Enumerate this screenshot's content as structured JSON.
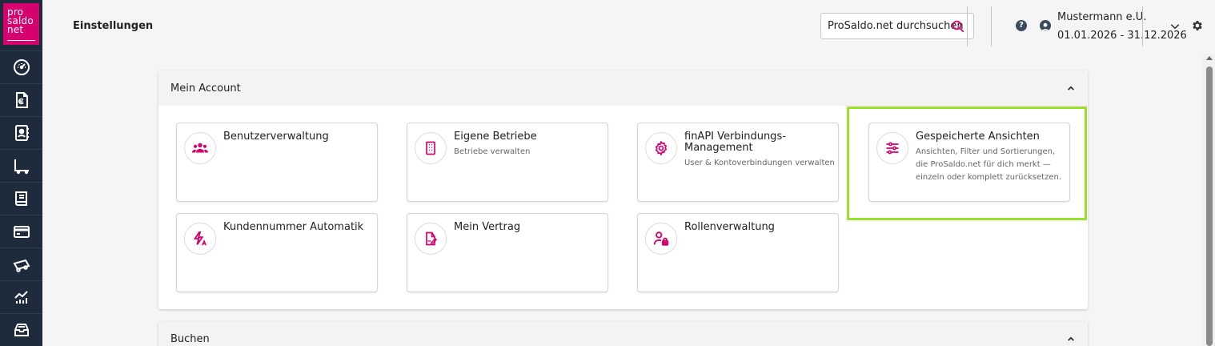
{
  "logo": {
    "line1": "pro",
    "line2": "saldo",
    "line3": "net"
  },
  "sidebar": {
    "items": [
      {
        "icon": "dashboard-icon"
      },
      {
        "icon": "euro-document-icon"
      },
      {
        "icon": "contacts-icon"
      },
      {
        "icon": "ledger-icon"
      },
      {
        "icon": "book-icon"
      },
      {
        "icon": "credit-card-icon"
      },
      {
        "icon": "vehicle-icon"
      },
      {
        "icon": "chart-icon"
      },
      {
        "icon": "inbox-icon"
      }
    ]
  },
  "header": {
    "title": "Einstellungen",
    "search_placeholder": "ProSaldo.net durchsuchen",
    "user_name": "Mustermann e.U.",
    "period": "01.01.2026 - 31.12.2026",
    "help_label": "?"
  },
  "sections": [
    {
      "title": "Mein Account",
      "cards": [
        {
          "title": "Benutzerverwaltung",
          "desc": "",
          "icon": "users-icon"
        },
        {
          "title": "Eigene Betriebe",
          "desc": "Betriebe verwalten",
          "icon": "building-icon"
        },
        {
          "title": "finAPI Verbindungs-Management",
          "desc": "User & Kontoverbindungen verwalten",
          "icon": "settings-gear-icon"
        },
        {
          "title": "Gespeicherte Ansichten",
          "desc": "Ansichten, Filter und Sortierungen, die ProSaldo.net für dich merkt — einzeln oder komplett zurücksetzen.",
          "icon": "sliders-icon"
        },
        {
          "title": "Kundennummer Automatik",
          "desc": "",
          "icon": "auto-number-icon"
        },
        {
          "title": "Mein Vertrag",
          "desc": "",
          "icon": "contract-icon"
        },
        {
          "title": "Rollenverwaltung",
          "desc": "",
          "icon": "user-lock-icon"
        }
      ]
    },
    {
      "title": "Buchen"
    }
  ],
  "colors": {
    "accent": "#d6006e",
    "sidebar": "#1d2b3d",
    "highlight": "#99e02a"
  }
}
